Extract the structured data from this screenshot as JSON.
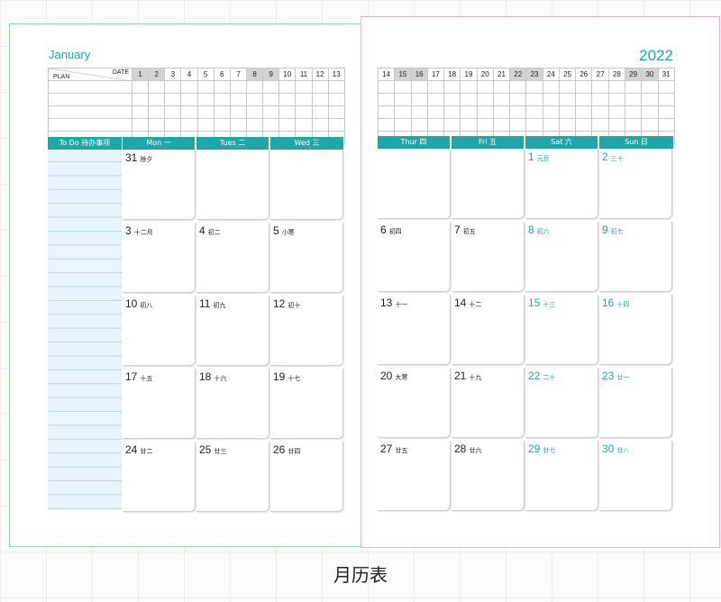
{
  "left_page": {
    "month": "January",
    "date_label": "DATE",
    "plan_label": "PLAN",
    "header_days": [
      "1",
      "2",
      "3",
      "4",
      "5",
      "6",
      "7",
      "8",
      "9",
      "10",
      "11",
      "12",
      "13"
    ],
    "todo_label": "To Do  待办事项",
    "weekdays": [
      "Mon  一",
      "Tues  二",
      "Wed 三"
    ],
    "weeks": [
      [
        {
          "d": "31",
          "l": "除夕"
        },
        {
          "d": "",
          "l": ""
        },
        {
          "d": "",
          "l": ""
        }
      ],
      [
        {
          "d": "3",
          "l": "十二月"
        },
        {
          "d": "4",
          "l": "初二"
        },
        {
          "d": "5",
          "l": "小寒"
        }
      ],
      [
        {
          "d": "10",
          "l": "初八"
        },
        {
          "d": "11",
          "l": "初九"
        },
        {
          "d": "12",
          "l": "初十"
        }
      ],
      [
        {
          "d": "17",
          "l": "十五"
        },
        {
          "d": "18",
          "l": "十六"
        },
        {
          "d": "19",
          "l": "十七"
        }
      ],
      [
        {
          "d": "24",
          "l": "廿二"
        },
        {
          "d": "25",
          "l": "廿三"
        },
        {
          "d": "26",
          "l": "廿四"
        }
      ]
    ]
  },
  "right_page": {
    "year": "2022",
    "header_days": [
      "14",
      "15",
      "16",
      "17",
      "18",
      "19",
      "20",
      "21",
      "22",
      "23",
      "24",
      "25",
      "26",
      "27",
      "28",
      "29",
      "30",
      "31"
    ],
    "weekdays": [
      "Thur 四",
      "Fri  五",
      "Sat 六",
      "Sun 日"
    ],
    "weeks": [
      [
        {
          "d": "",
          "l": ""
        },
        {
          "d": "",
          "l": ""
        },
        {
          "d": "1",
          "l": "元旦"
        },
        {
          "d": "2",
          "l": "三十"
        }
      ],
      [
        {
          "d": "6",
          "l": "初四"
        },
        {
          "d": "7",
          "l": "初五"
        },
        {
          "d": "8",
          "l": "初六"
        },
        {
          "d": "9",
          "l": "初七"
        }
      ],
      [
        {
          "d": "13",
          "l": "十一"
        },
        {
          "d": "14",
          "l": "十二"
        },
        {
          "d": "15",
          "l": "十三"
        },
        {
          "d": "16",
          "l": "十四"
        }
      ],
      [
        {
          "d": "20",
          "l": "大寒"
        },
        {
          "d": "21",
          "l": "十九"
        },
        {
          "d": "22",
          "l": "二十"
        },
        {
          "d": "23",
          "l": "廿一"
        }
      ],
      [
        {
          "d": "27",
          "l": "廿五"
        },
        {
          "d": "28",
          "l": "廿六"
        },
        {
          "d": "29",
          "l": "廿七"
        },
        {
          "d": "30",
          "l": "廿八"
        }
      ]
    ]
  },
  "caption": "月历表",
  "colors": {
    "accent": "#1fa6a6",
    "todo_bg": "#e8f4fb",
    "weekend_header": "#d3d3d3"
  }
}
